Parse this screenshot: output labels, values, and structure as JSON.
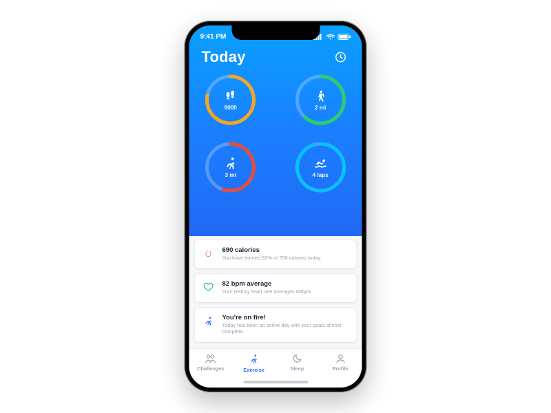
{
  "statusbar": {
    "time": "9:41 PM"
  },
  "header": {
    "title": "Today"
  },
  "colors": {
    "steps": "#f5a623",
    "walk": "#2ecc71",
    "run": "#e74c3c",
    "swim": "#09c1ff"
  },
  "rings": {
    "steps": {
      "label": "9000",
      "progress": 0.78
    },
    "walk": {
      "label": "2 mi",
      "progress": 0.62
    },
    "run": {
      "label": "3 mi",
      "progress": 0.55
    },
    "swim": {
      "label": "4 laps",
      "progress": 0.95
    }
  },
  "cards": {
    "calories": {
      "title": "690 calories",
      "sub": "You have burned 92% of 750 calories today."
    },
    "heart": {
      "title": "82 bpm average",
      "sub": "Your resting heart rate averages 60bpm."
    },
    "fire": {
      "title": "You're on fire!",
      "sub": "Today has been an active day with your goals almost complete."
    }
  },
  "tabs": {
    "challenges": "Challenges",
    "exercise": "Exercise",
    "sleep": "Sleep",
    "profile": "Profile"
  }
}
